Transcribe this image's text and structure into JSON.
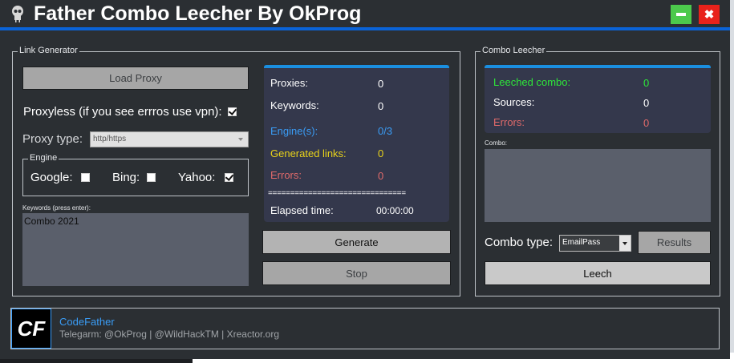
{
  "window": {
    "title": "Father Combo Leecher By OkProg",
    "minimize_icon": "minimize-icon",
    "close_icon": "close-icon",
    "close_glyph": "✖"
  },
  "link_generator": {
    "legend": "Link Generator",
    "load_proxy_label": "Load Proxy",
    "proxyless_label": "Proxyless (if you see errros use vpn):",
    "proxyless_checked": true,
    "proxy_type_label": "Proxy type:",
    "proxy_type_value": "http/https",
    "engine": {
      "legend": "Engine",
      "google_label": "Google:",
      "google_checked": false,
      "bing_label": "Bing:",
      "bing_checked": false,
      "yahoo_label": "Yahoo:",
      "yahoo_checked": true
    },
    "keywords_label": "Keywords (press enter):",
    "keywords_value": "Combo 2021"
  },
  "stats": {
    "proxies_label": "Proxies:",
    "proxies_value": "0",
    "keywords_label": "Keywords:",
    "keywords_value": "0",
    "engines_label": "Engine(s):",
    "engines_value": "0/3",
    "generated_label": "Generated links:",
    "generated_value": "0",
    "errors_label": "Errors:",
    "errors_value": "0",
    "separator": "===============================",
    "elapsed_label": "Elapsed time:",
    "elapsed_value": "00:00:00"
  },
  "actions": {
    "generate_label": "Generate",
    "stop_label": "Stop"
  },
  "combo_leecher": {
    "legend": "Combo Leecher",
    "leeched_label": "Leeched combo:",
    "leeched_value": "0",
    "sources_label": "Sources:",
    "sources_value": "0",
    "errors_label": "Errors:",
    "errors_value": "0",
    "combo_label": "Combo:",
    "combo_type_label": "Combo type:",
    "combo_type_value": "EmailPass",
    "results_label": "Results",
    "leech_label": "Leech"
  },
  "footer": {
    "logo_text": "CF",
    "name": "CodeFather",
    "contacts": "Telegarm: @OkProg | @WildHackTM | Xreactor.org"
  },
  "colors": {
    "accent_blue": "#0a63d8",
    "green": "#2ee63a",
    "blue_text": "#3a9cf5",
    "yellow": "#e8d21a",
    "red": "#e06a6a"
  }
}
